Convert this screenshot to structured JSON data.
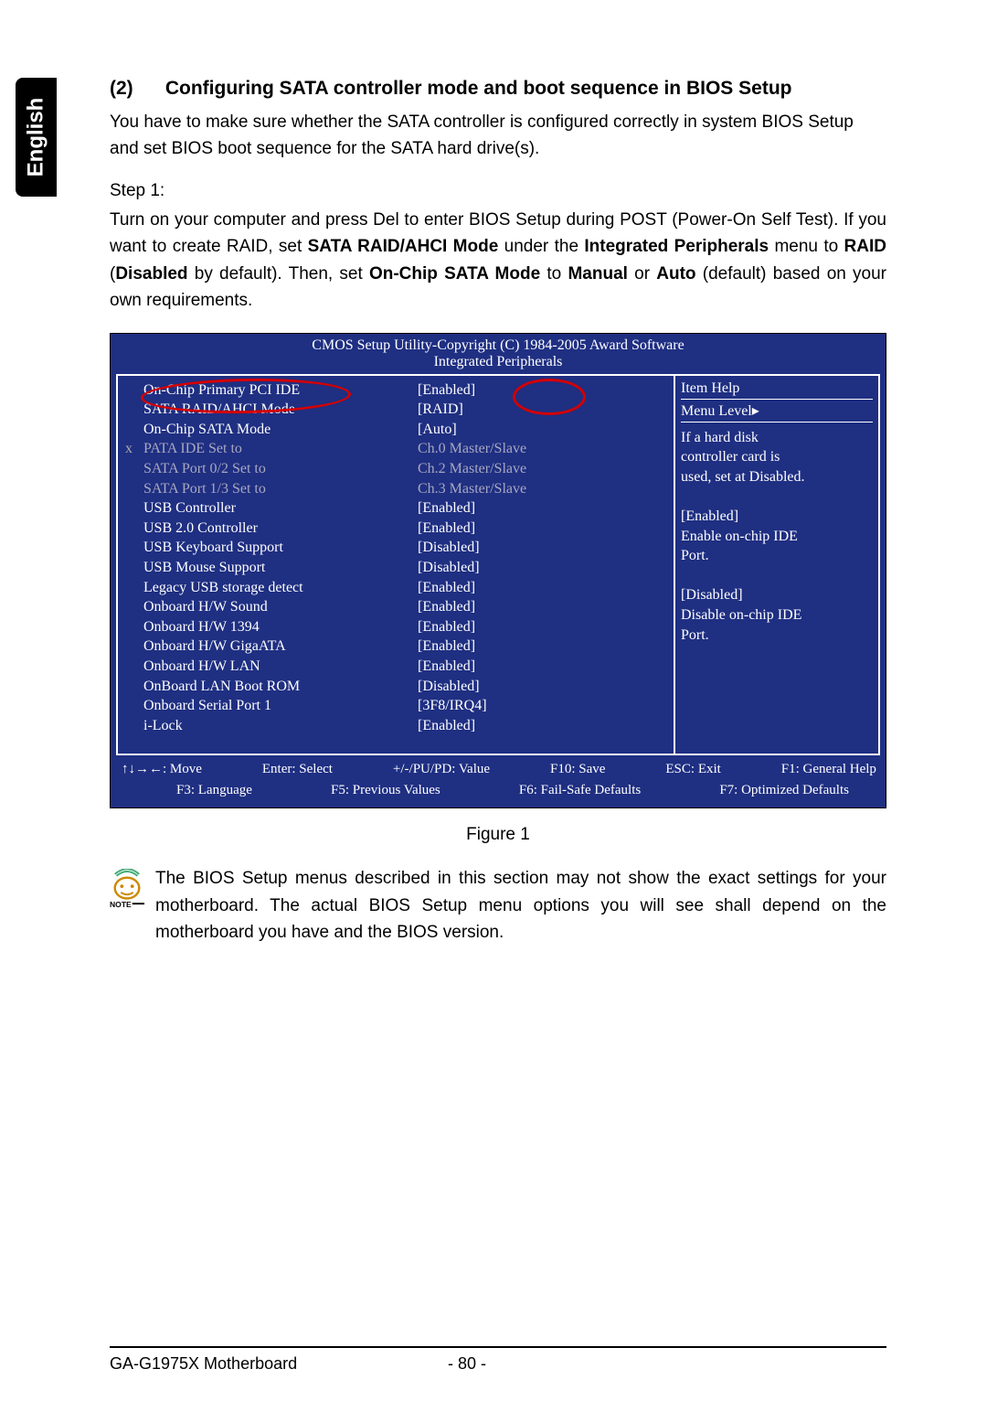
{
  "sidebar": {
    "language": "English"
  },
  "heading": {
    "num": "(2)",
    "title": "Configuring SATA controller mode and boot sequence in BIOS Setup"
  },
  "intro": "You have to make sure whether the SATA controller is configured correctly in system BIOS Setup and set BIOS boot sequence for the SATA hard drive(s).",
  "step_label": "Step 1:",
  "step_text": {
    "t1": "Turn on your computer and press Del to enter BIOS Setup during POST (Power-On Self Test). If you want to create RAID, set ",
    "b1": "SATA RAID/AHCI Mode",
    "t2": " under the ",
    "b2": "Integrated Peripherals",
    "t3": " menu to ",
    "b3": "RAID",
    "t4": " (",
    "b4": "Disabled",
    "t5": " by default). Then, set ",
    "b5": "On-Chip SATA Mode",
    "t6": " to ",
    "b6": "Manual",
    "t7": " or ",
    "b7": "Auto",
    "t8": " (default) based on your own requirements."
  },
  "bios": {
    "header": "CMOS Setup Utility-Copyright (C) 1984-2005 Award Software",
    "subheader": "Integrated Peripherals",
    "rows": [
      {
        "prefix": "",
        "label": "On-Chip Primary PCI IDE",
        "value": "[Enabled]",
        "grey": false
      },
      {
        "prefix": "",
        "label": "SATA RAID/AHCI Mode",
        "value": "[RAID]",
        "grey": false
      },
      {
        "prefix": "",
        "label": "On-Chip SATA Mode",
        "value": "[Auto]",
        "grey": false
      },
      {
        "prefix": "x",
        "label": "PATA IDE Set to",
        "value": "Ch.0 Master/Slave",
        "grey": true
      },
      {
        "prefix": "",
        "label": "SATA Port 0/2 Set to",
        "value": "Ch.2 Master/Slave",
        "grey": true
      },
      {
        "prefix": "",
        "label": "SATA Port 1/3 Set to",
        "value": "Ch.3 Master/Slave",
        "grey": true
      },
      {
        "prefix": "",
        "label": "USB Controller",
        "value": "[Enabled]",
        "grey": false
      },
      {
        "prefix": "",
        "label": "USB 2.0 Controller",
        "value": "[Enabled]",
        "grey": false
      },
      {
        "prefix": "",
        "label": "USB Keyboard Support",
        "value": "[Disabled]",
        "grey": false
      },
      {
        "prefix": "",
        "label": "USB Mouse Support",
        "value": "[Disabled]",
        "grey": false
      },
      {
        "prefix": "",
        "label": "Legacy USB storage detect",
        "value": "[Enabled]",
        "grey": false
      },
      {
        "prefix": "",
        "label": "Onboard H/W Sound",
        "value": "[Enabled]",
        "grey": false
      },
      {
        "prefix": "",
        "label": "Onboard H/W 1394",
        "value": "[Enabled]",
        "grey": false
      },
      {
        "prefix": "",
        "label": "Onboard H/W GigaATA",
        "value": "[Enabled]",
        "grey": false
      },
      {
        "prefix": "",
        "label": "Onboard H/W LAN",
        "value": "[Enabled]",
        "grey": false
      },
      {
        "prefix": "",
        "label": "OnBoard LAN Boot ROM",
        "value": "[Disabled]",
        "grey": false
      },
      {
        "prefix": "",
        "label": "Onboard Serial Port 1",
        "value": "[3F8/IRQ4]",
        "grey": false
      },
      {
        "prefix": "",
        "label": "i-Lock",
        "value": "[Enabled]",
        "grey": false
      }
    ],
    "help": {
      "title": "Item Help",
      "menu_level": "Menu Level▸",
      "lines": [
        "If a hard disk",
        "controller card is",
        "used, set at Disabled.",
        "",
        "[Enabled]",
        "Enable on-chip IDE",
        "Port.",
        "",
        "[Disabled]",
        "Disable on-chip IDE",
        "Port."
      ]
    },
    "footer": {
      "r1": [
        "↑↓→←: Move",
        "Enter: Select",
        "+/-/PU/PD: Value",
        "F10: Save",
        "ESC: Exit",
        "F1: General Help"
      ],
      "r2": [
        "F3: Language",
        "F5: Previous Values",
        "F6: Fail-Safe Defaults",
        "F7: Optimized Defaults"
      ]
    }
  },
  "figure_caption": "Figure 1",
  "note": "The BIOS Setup menus described in this section may not show the exact settings for your motherboard. The actual BIOS Setup menu options you will see shall depend on the motherboard you have and the BIOS version.",
  "footer": {
    "product": "GA-G1975X Motherboard",
    "page": "- 80 -"
  }
}
